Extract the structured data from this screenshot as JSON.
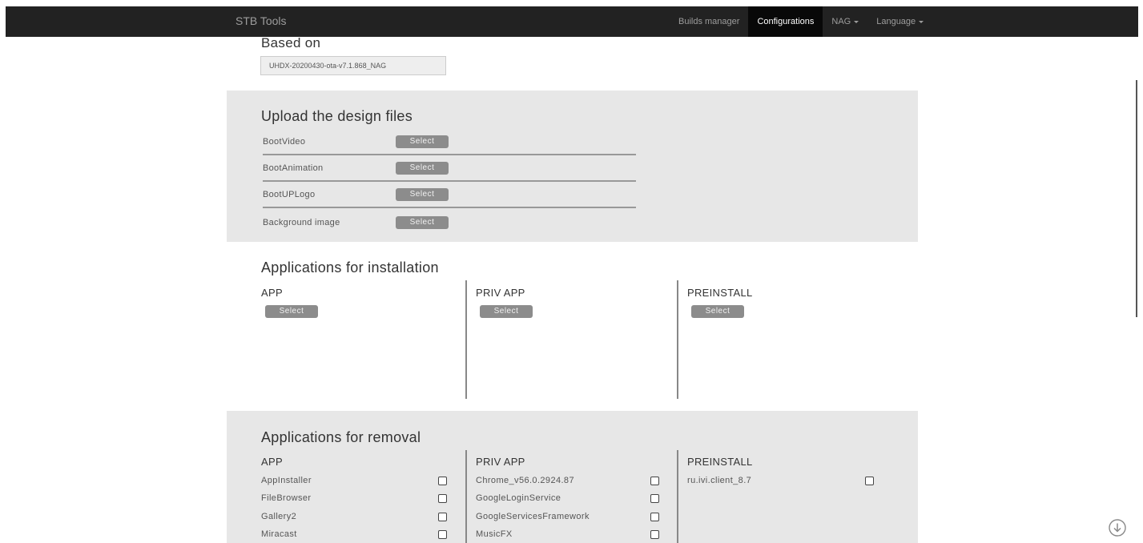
{
  "navbar": {
    "brand": "STB Tools",
    "items": [
      {
        "label": "Builds manager"
      },
      {
        "label": "Configurations"
      },
      {
        "label": "NAG"
      },
      {
        "label": "Language"
      }
    ]
  },
  "based_on": {
    "title": "Based on",
    "value": "UHDX-20200430-ota-v7.1.868_NAG"
  },
  "upload": {
    "title": "Upload the design files",
    "rows": [
      {
        "label": "BootVideo",
        "button": "Select"
      },
      {
        "label": "BootAnimation",
        "button": "Select"
      },
      {
        "label": "BootUPLogo",
        "button": "Select"
      },
      {
        "label": "Background image",
        "button": "Select"
      }
    ]
  },
  "install": {
    "title": "Applications for installation",
    "columns": [
      {
        "title": "APP",
        "button": "Select"
      },
      {
        "title": "PRIV APP",
        "button": "Select"
      },
      {
        "title": "PREINSTALL",
        "button": "Select"
      }
    ]
  },
  "removal": {
    "title": "Applications for removal",
    "columns": [
      {
        "title": "APP",
        "items": [
          "AppInstaller",
          "FileBrowser",
          "Gallery2",
          "Miracast"
        ]
      },
      {
        "title": "PRIV APP",
        "items": [
          "Chrome_v56.0.2924.87",
          "GoogleLoginService",
          "GoogleServicesFramework",
          "MusicFX"
        ]
      },
      {
        "title": "PREINSTALL",
        "items": [
          "ru.ivi.client_8.7"
        ]
      }
    ]
  },
  "icons": {
    "scroll_down": "download-circle-icon"
  }
}
